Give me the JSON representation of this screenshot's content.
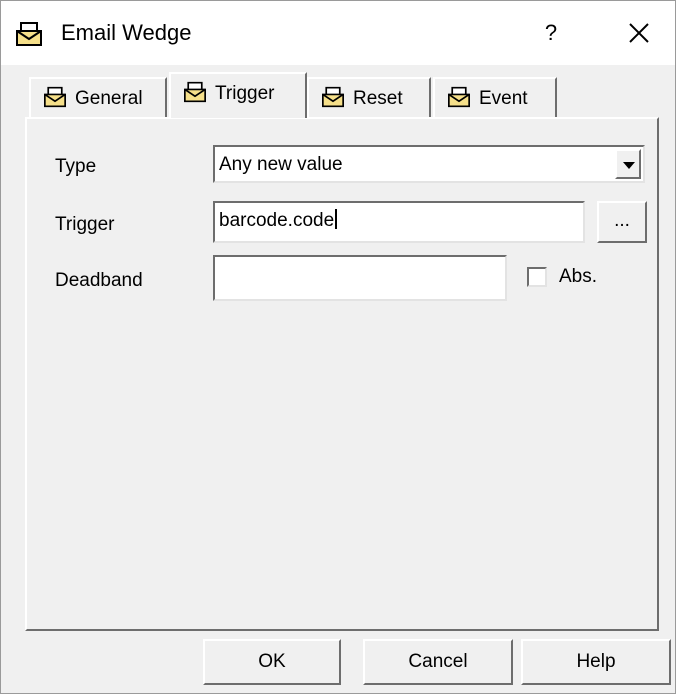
{
  "window": {
    "title": "Email Wedge",
    "help_label": "?",
    "close_icon": "close-icon",
    "app_icon": "envelope-icon"
  },
  "tabs": [
    {
      "label": "General",
      "icon": "envelope-icon",
      "active": false
    },
    {
      "label": "Trigger",
      "icon": "envelope-icon",
      "active": true
    },
    {
      "label": "Reset",
      "icon": "envelope-icon",
      "active": false
    },
    {
      "label": "Event",
      "icon": "envelope-icon",
      "active": false
    }
  ],
  "trigger": {
    "type_label": "Type",
    "type_value": "Any new value",
    "trigger_label": "Trigger",
    "trigger_value": "barcode.code",
    "browse_label": "...",
    "deadband_label": "Deadband",
    "deadband_value": "",
    "abs_label": "Abs.",
    "abs_checked": false
  },
  "buttons": {
    "ok": "OK",
    "cancel": "Cancel",
    "help": "Help"
  },
  "colors": {
    "face": "#f0f0f0",
    "shadow": "#6d6d6d",
    "highlight": "#ffffff",
    "field": "#ffffff"
  }
}
